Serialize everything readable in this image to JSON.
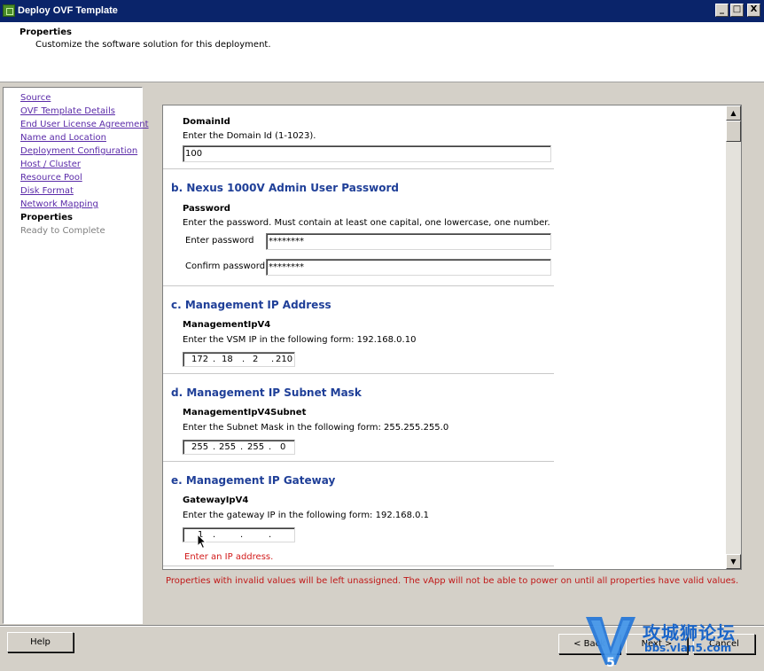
{
  "window": {
    "title": "Deploy OVF Template",
    "controls": [
      "_",
      "□",
      "X"
    ]
  },
  "header": {
    "title": "Properties",
    "subtitle": "Customize the software solution for this deployment."
  },
  "sidebar": {
    "items": [
      {
        "label": "Source",
        "state": "link"
      },
      {
        "label": "OVF Template Details",
        "state": "link"
      },
      {
        "label": "End User License Agreement",
        "state": "link"
      },
      {
        "label": "Name and Location",
        "state": "link"
      },
      {
        "label": "Deployment Configuration",
        "state": "link"
      },
      {
        "label": "Host / Cluster",
        "state": "link"
      },
      {
        "label": "Resource Pool",
        "state": "link"
      },
      {
        "label": "Disk Format",
        "state": "link"
      },
      {
        "label": "Network Mapping",
        "state": "link"
      },
      {
        "label": "Properties",
        "state": "current"
      },
      {
        "label": "Ready to Complete",
        "state": "disabled"
      }
    ]
  },
  "content": {
    "domain": {
      "field": "DomainId",
      "desc": "Enter the Domain Id (1-1023).",
      "value": "100"
    },
    "admin": {
      "title": "b. Nexus 1000V Admin User Password",
      "field": "Password",
      "desc": "Enter the password. Must contain at least one capital, one lowercase, one number.",
      "enter_label": "Enter password",
      "enter_value": "********",
      "confirm_label": "Confirm password",
      "confirm_value": "********"
    },
    "mgmt_ip": {
      "title": "c. Management IP Address",
      "field": "ManagementIpV4",
      "desc": "Enter the VSM IP in the following form: 192.168.0.10",
      "octets": [
        "172",
        "18",
        "2",
        "210"
      ]
    },
    "mgmt_mask": {
      "title": "d. Management IP Subnet Mask",
      "field": "ManagementIpV4Subnet",
      "desc": "Enter the Subnet Mask in the following form: 255.255.255.0",
      "octets": [
        "255",
        "255",
        "255",
        "0"
      ]
    },
    "mgmt_gw": {
      "title": "e. Management IP Gateway",
      "field": "GatewayIpV4",
      "desc": "Enter the gateway IP in the following form: 192.168.0.1",
      "octets": [
        "1",
        "",
        "",
        ""
      ],
      "error": "Enter an IP address."
    }
  },
  "warning": "Properties with invalid values will be left unassigned. The vApp will not be able to power on until all properties have valid values.",
  "buttons": {
    "help": "Help",
    "back": "< Back",
    "next": "Next >",
    "cancel": "Cancel"
  },
  "watermark": {
    "brand": "攻城狮论坛",
    "url": "bbs.vlan5.com"
  }
}
